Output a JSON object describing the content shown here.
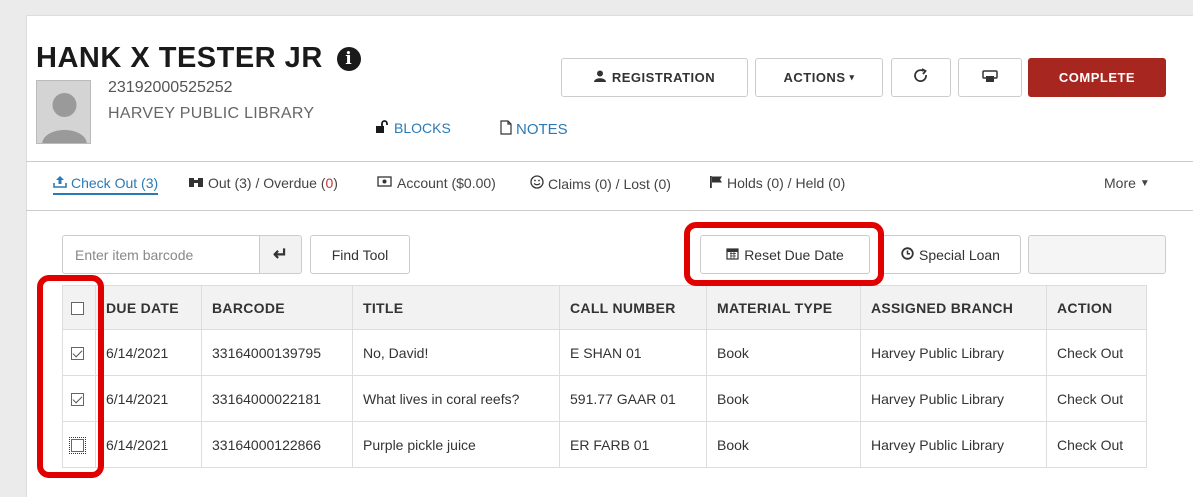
{
  "patron": {
    "name": "HANK X TESTER JR",
    "id": "23192000525252",
    "library": "HARVEY PUBLIC LIBRARY",
    "blocks_label": "BLOCKS",
    "notes_label": "NOTES"
  },
  "header_buttons": {
    "registration": "REGISTRATION",
    "actions": "ACTIONS",
    "complete": "COMPLETE"
  },
  "tabs": {
    "checkout": "Check Out (3)",
    "out_prefix": "Out (3) / Overdue (",
    "overdue_count": "0",
    "out_suffix": ")",
    "account": "Account ($0.00)",
    "claims": "Claims (0) / Lost (0)",
    "holds": "Holds (0) / Held (0)",
    "more": "More"
  },
  "toolbar": {
    "barcode_placeholder": "Enter item barcode",
    "find_tool": "Find Tool",
    "reset_due_date": "Reset Due Date",
    "special_loan": "Special Loan"
  },
  "table": {
    "headers": [
      "DUE DATE",
      "BARCODE",
      "TITLE",
      "CALL NUMBER",
      "MATERIAL TYPE",
      "ASSIGNED BRANCH",
      "ACTION"
    ],
    "rows": [
      {
        "checked": true,
        "due_date": "6/14/2021",
        "barcode": "33164000139795",
        "title": "No, David!",
        "call_number": "E SHAN 01",
        "material_type": "Book",
        "branch": "Harvey Public Library",
        "action": "Check Out"
      },
      {
        "checked": true,
        "due_date": "6/14/2021",
        "barcode": "33164000022181",
        "title": "What lives in coral reefs?",
        "call_number": "591.77 GAAR 01",
        "material_type": "Book",
        "branch": "Harvey Public Library",
        "action": "Check Out"
      },
      {
        "checked": false,
        "due_date": "6/14/2021",
        "barcode": "33164000122866",
        "title": "Purple pickle juice",
        "call_number": "ER FARB 01",
        "material_type": "Book",
        "branch": "Harvey Public Library",
        "action": "Check Out"
      }
    ]
  },
  "colors": {
    "accent": "#2b7ab5",
    "complete": "#a7261f",
    "highlight": "#e00000",
    "overdue": "#c9302c"
  }
}
